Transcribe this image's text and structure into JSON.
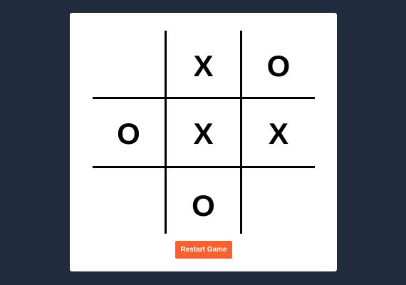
{
  "game": {
    "board": [
      [
        "",
        "X",
        "O"
      ],
      [
        "O",
        "X",
        "X"
      ],
      [
        "",
        "O",
        ""
      ]
    ]
  },
  "controls": {
    "restart_label": "Restart Game"
  },
  "colors": {
    "background": "#212c3e",
    "card": "#ffffff",
    "grid": "#000000",
    "mark": "#000000",
    "restart_button": "#f5622f"
  }
}
